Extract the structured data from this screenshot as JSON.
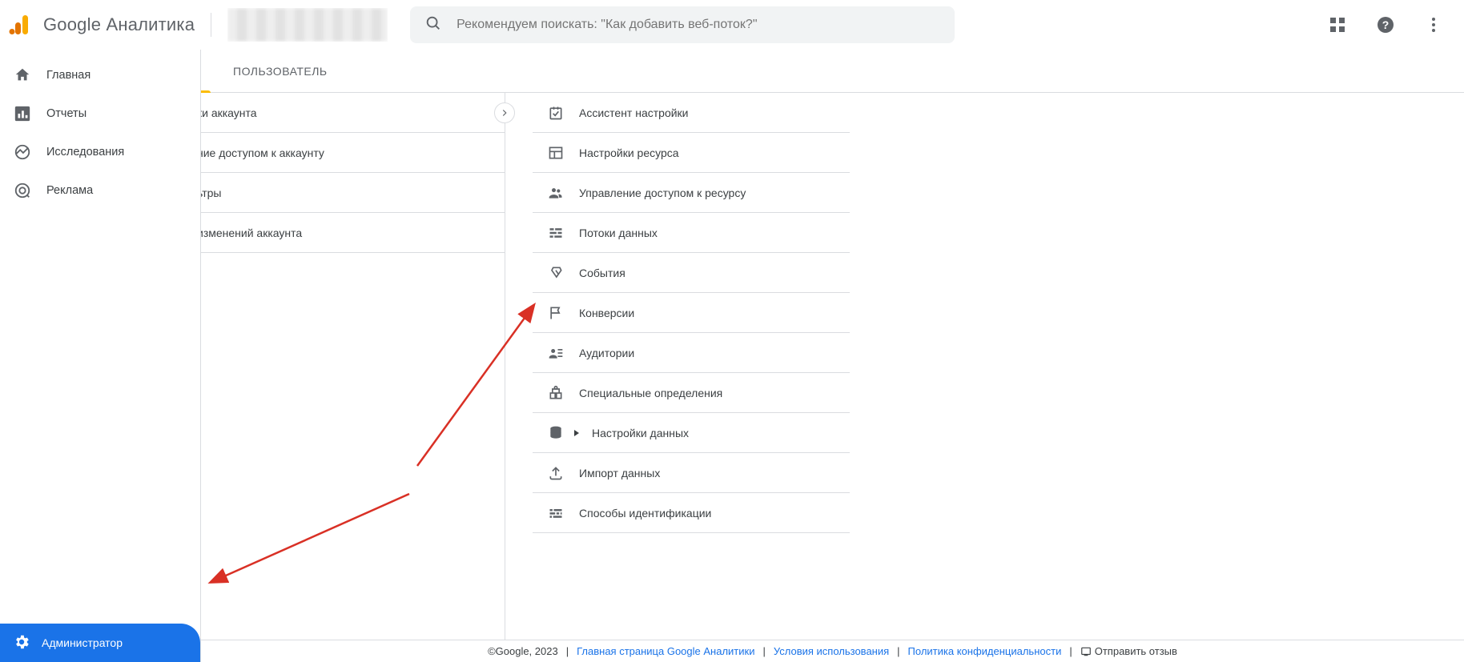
{
  "header": {
    "app_title_prefix": "Google",
    "app_title_rest": " Аналитика",
    "search_placeholder": "Рекомендуем поискать: \"Как добавить веб-поток?\""
  },
  "nav": {
    "items": [
      {
        "label": "Главная",
        "icon": "home"
      },
      {
        "label": "Отчеты",
        "icon": "reports"
      },
      {
        "label": "Исследования",
        "icon": "explore"
      },
      {
        "label": "Реклама",
        "icon": "ads"
      }
    ],
    "admin_label": "Администратор"
  },
  "content": {
    "tab_label": "ПОЛЬЗОВАТЕЛЬ",
    "account_column": [
      "ки аккаунта",
      "ние доступом к аккаунту",
      "ьтры",
      "изменений аккаунта"
    ],
    "resource_column": [
      {
        "label": "Ассистент настройки",
        "icon": "assistant"
      },
      {
        "label": "Настройки ресурса",
        "icon": "settings-panel"
      },
      {
        "label": "Управление доступом к ресурсу",
        "icon": "people"
      },
      {
        "label": "Потоки данных",
        "icon": "streams"
      },
      {
        "label": "События",
        "icon": "events"
      },
      {
        "label": "Конверсии",
        "icon": "flag"
      },
      {
        "label": "Аудитории",
        "icon": "audiences"
      },
      {
        "label": "Специальные определения",
        "icon": "definitions"
      },
      {
        "label": "Настройки данных",
        "icon": "data-settings",
        "expandable": true
      },
      {
        "label": "Импорт данных",
        "icon": "upload"
      },
      {
        "label": "Способы идентификации",
        "icon": "identity"
      }
    ]
  },
  "footer": {
    "copyright": "©Google, 2023",
    "links": [
      "Главная страница Google Аналитики",
      "Условия использования",
      "Политика конфиденциальности"
    ],
    "feedback": "Отправить отзыв"
  }
}
